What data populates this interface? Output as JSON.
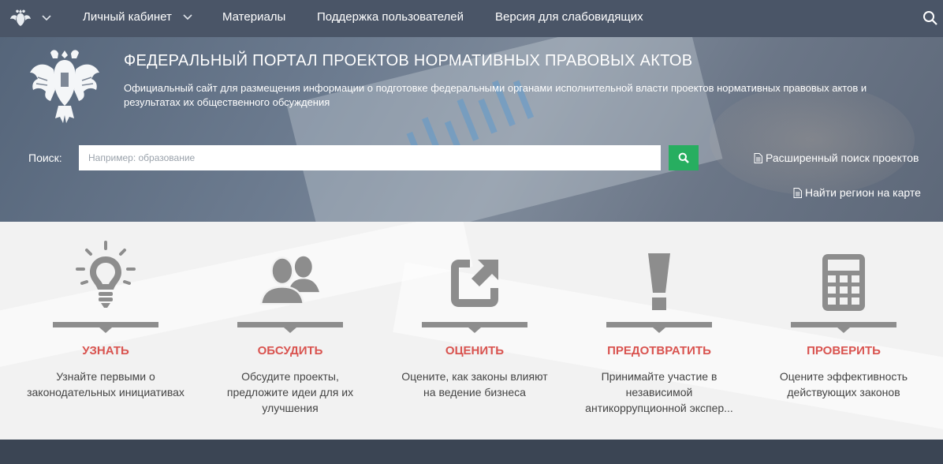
{
  "nav": {
    "cabinet": "Личный кабинет",
    "materials": "Материалы",
    "support": "Поддержка пользователей",
    "low_vision": "Версия для слабовидящих"
  },
  "hero": {
    "title": "ФЕДЕРАЛЬНЫЙ ПОРТАЛ ПРОЕКТОВ НОРМАТИВНЫХ ПРАВОВЫХ АКТОВ",
    "subtitle": "Официальный сайт для размещения информации о подготовке федеральными органами исполнительной власти проектов нормативных правовых актов и результатах их общественного обсуждения"
  },
  "search": {
    "label": "Поиск:",
    "placeholder": "Например: образование",
    "advanced_link": "Расширенный поиск проектов",
    "map_link": "Найти регион на карте"
  },
  "features": [
    {
      "title": "УЗНАТЬ",
      "desc": "Узнайте первыми о законодательных инициативах",
      "icon": "lightbulb-icon"
    },
    {
      "title": "ОБСУДИТЬ",
      "desc": "Обсудите проекты, предложите идеи для их улучшения",
      "icon": "users-icon"
    },
    {
      "title": "ОЦЕНИТЬ",
      "desc": "Оцените, как законы влияют на ведение бизнеса",
      "icon": "external-link-icon"
    },
    {
      "title": "ПРЕДОТВРАТИТЬ",
      "desc": "Принимайте участие в независимой антикоррупционной экспер...",
      "icon": "exclamation-icon"
    },
    {
      "title": "ПРОВЕРИТЬ",
      "desc": "Оцените эффективность действующих законов",
      "icon": "calculator-icon"
    }
  ],
  "colors": {
    "nav_bg": "#4a5567",
    "accent_green": "#27ae60",
    "feature_title": "#d9534f",
    "icon_gray": "#8d8d8d"
  }
}
